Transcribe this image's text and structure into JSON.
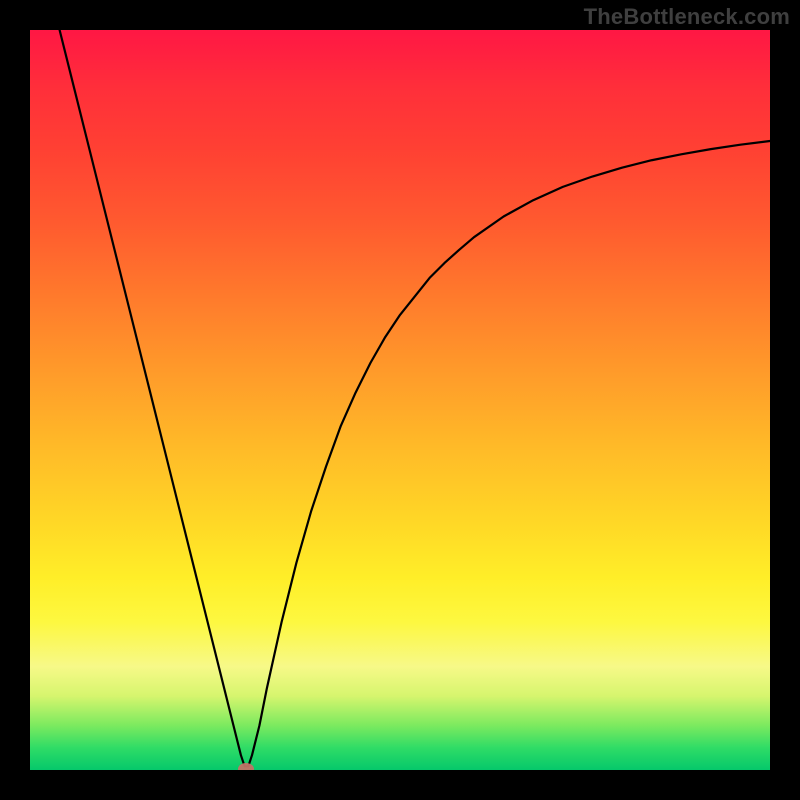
{
  "watermark": "TheBottleneck.com",
  "marker": {
    "color": "#c07366",
    "x_frac": 0.292,
    "y_frac": 0.999
  },
  "chart_data": {
    "type": "line",
    "title": "",
    "xlabel": "",
    "ylabel": "",
    "xlim": [
      0,
      1
    ],
    "ylim": [
      0,
      100
    ],
    "grid": false,
    "legend": false,
    "annotations": [],
    "curve_note": "Bottleneck-percentage curve. X is normalized component balance position (0–1). Y is bottleneck %. Minimum (~0%) near x≈0.29; rises steeply toward 100% at x→0 and asymptotically toward ~85% as x→1.",
    "series": [
      {
        "name": "bottleneck",
        "x": [
          0.04,
          0.06,
          0.08,
          0.1,
          0.12,
          0.14,
          0.16,
          0.18,
          0.2,
          0.22,
          0.24,
          0.26,
          0.275,
          0.285,
          0.29,
          0.295,
          0.3,
          0.31,
          0.32,
          0.34,
          0.36,
          0.38,
          0.4,
          0.42,
          0.44,
          0.46,
          0.48,
          0.5,
          0.52,
          0.54,
          0.56,
          0.58,
          0.6,
          0.64,
          0.68,
          0.72,
          0.76,
          0.8,
          0.84,
          0.88,
          0.92,
          0.96,
          1.0
        ],
        "y": [
          100.0,
          92.0,
          84.0,
          76.0,
          68.0,
          60.0,
          52.0,
          44.0,
          36.0,
          28.0,
          20.0,
          12.0,
          6.0,
          2.0,
          0.5,
          0.5,
          2.0,
          6.0,
          11.0,
          20.0,
          28.0,
          35.0,
          41.0,
          46.5,
          51.0,
          55.0,
          58.5,
          61.5,
          64.0,
          66.5,
          68.5,
          70.3,
          72.0,
          74.8,
          77.0,
          78.8,
          80.2,
          81.4,
          82.4,
          83.2,
          83.9,
          84.5,
          85.0
        ]
      }
    ]
  }
}
